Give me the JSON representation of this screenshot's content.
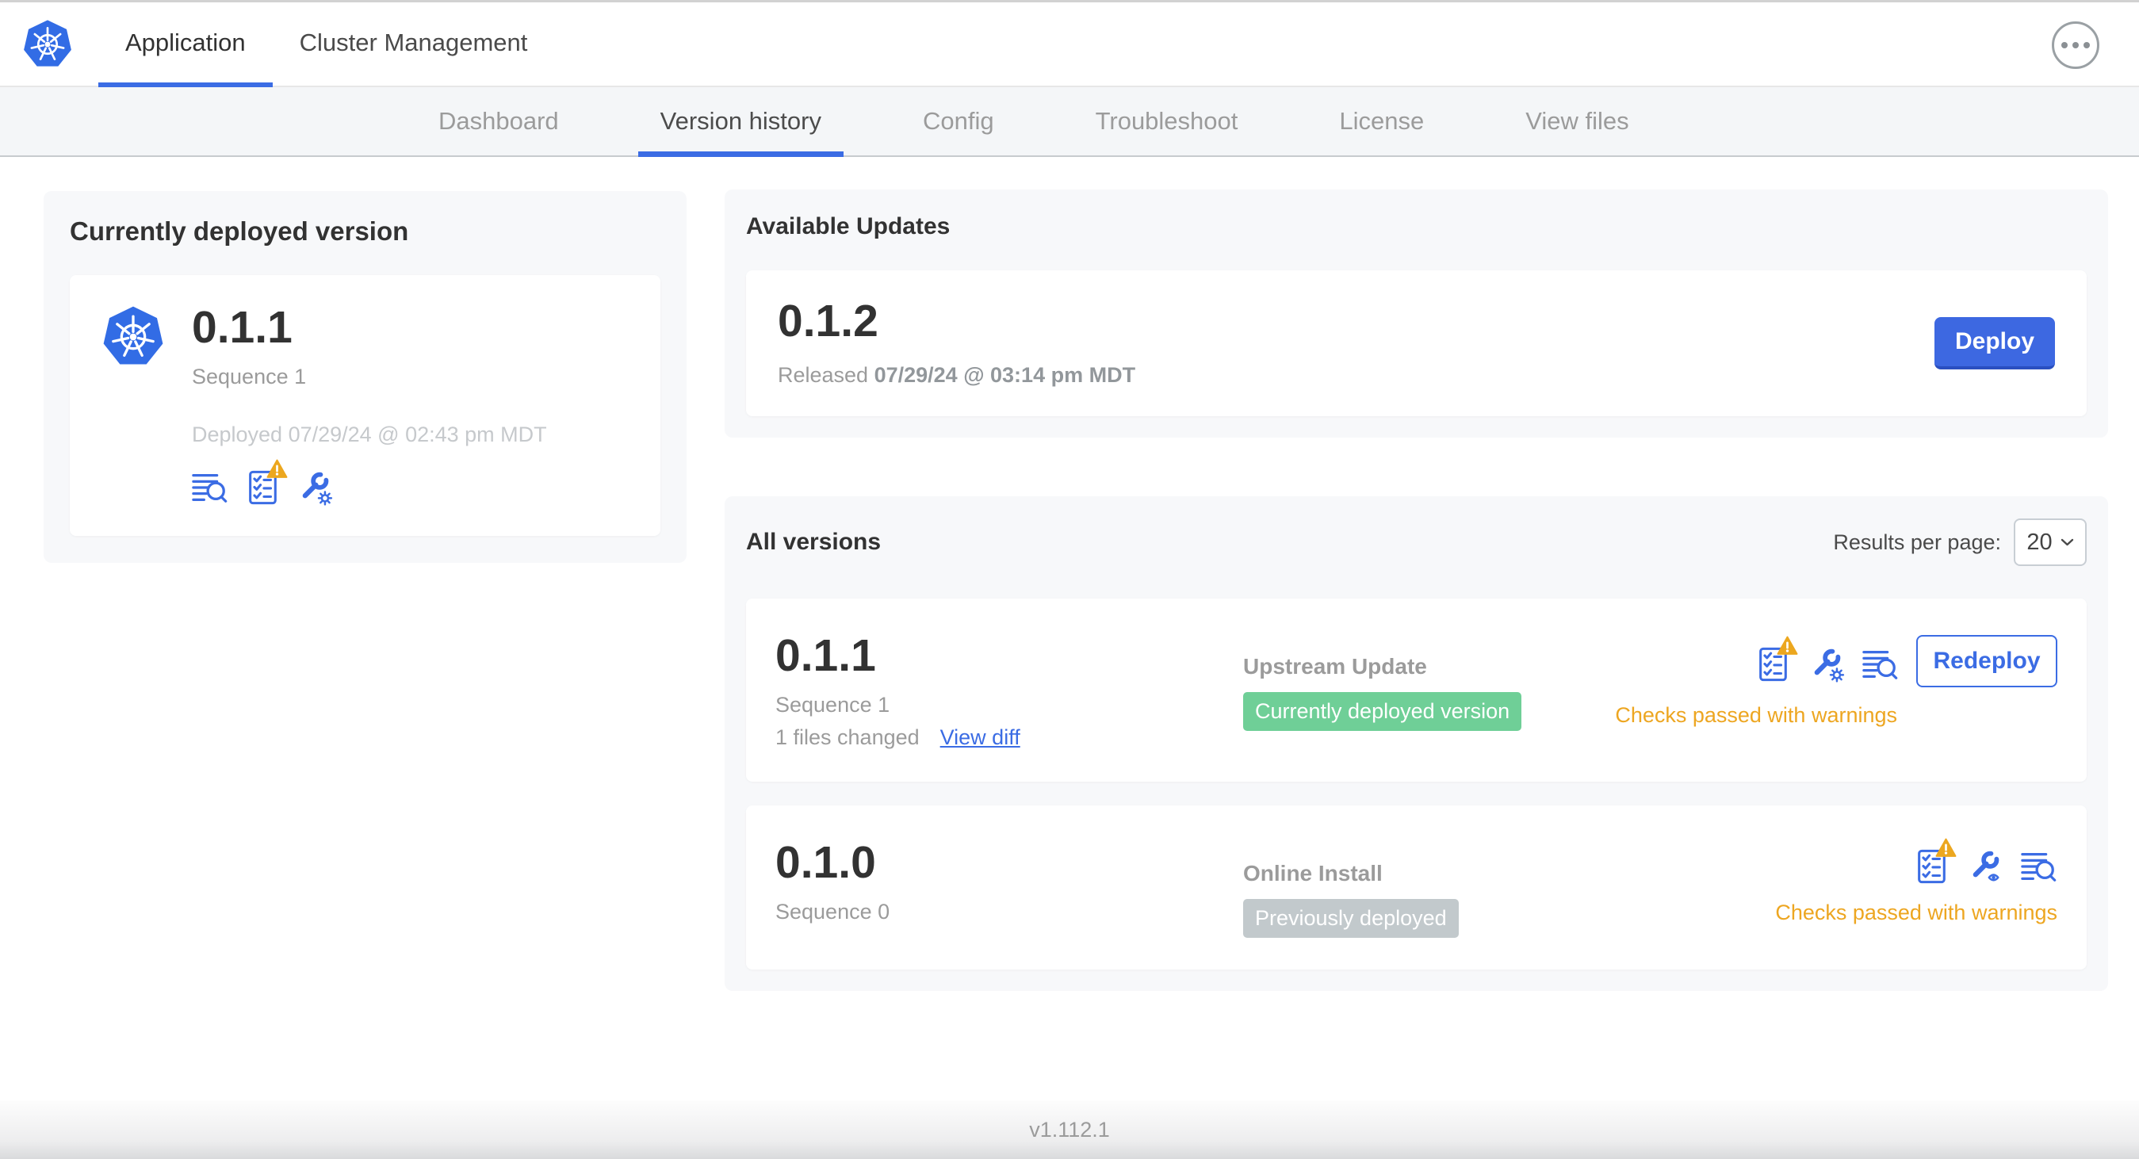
{
  "colors": {
    "accent_blue": "#3b6ce4",
    "button_blue": "#3d68e1",
    "k8s_logo_blue": "#326ce5",
    "green_badge": "#6fcf97",
    "gray_badge": "#c2c9cc",
    "warning_orange": "#eda621"
  },
  "topnav": {
    "tabs": [
      {
        "label": "Application",
        "active": true
      },
      {
        "label": "Cluster Management",
        "active": false
      }
    ]
  },
  "subnav": {
    "tabs": [
      "Dashboard",
      "Version history",
      "Config",
      "Troubleshoot",
      "License",
      "View files"
    ],
    "active": "Version history"
  },
  "current_version": {
    "title": "Currently deployed version",
    "version": "0.1.1",
    "sequence": "Sequence 1",
    "deployed": "Deployed 07/29/24 @ 02:43 pm MDT",
    "icons": [
      "release-notes",
      "preflight-checks-warning",
      "config-gear"
    ]
  },
  "available_updates": {
    "title": "Available Updates",
    "version": "0.1.2",
    "released_label": "Released",
    "released_date": "07/29/24 @ 03:14 pm MDT",
    "deploy_label": "Deploy"
  },
  "all_versions": {
    "title": "All versions",
    "results_per_page_label": "Results per page:",
    "results_per_page_value": "20",
    "rows": [
      {
        "version": "0.1.1",
        "sequence": "Sequence 1",
        "files_changed": "1 files changed",
        "view_diff": "View diff",
        "source": "Upstream Update",
        "badge": "Currently deployed version",
        "badge_color": "#6fcf97",
        "icons": [
          "preflight-checks-warning",
          "config-gear",
          "release-notes"
        ],
        "action": "Redeploy",
        "status": "Checks passed with warnings"
      },
      {
        "version": "0.1.0",
        "sequence": "Sequence 0",
        "source": "Online Install",
        "badge": "Previously deployed",
        "badge_color": "#c2c9cc",
        "icons": [
          "preflight-checks-warning",
          "config-view",
          "release-notes"
        ],
        "status": "Checks passed with warnings"
      }
    ]
  },
  "footer": {
    "version": "v1.112.1"
  }
}
